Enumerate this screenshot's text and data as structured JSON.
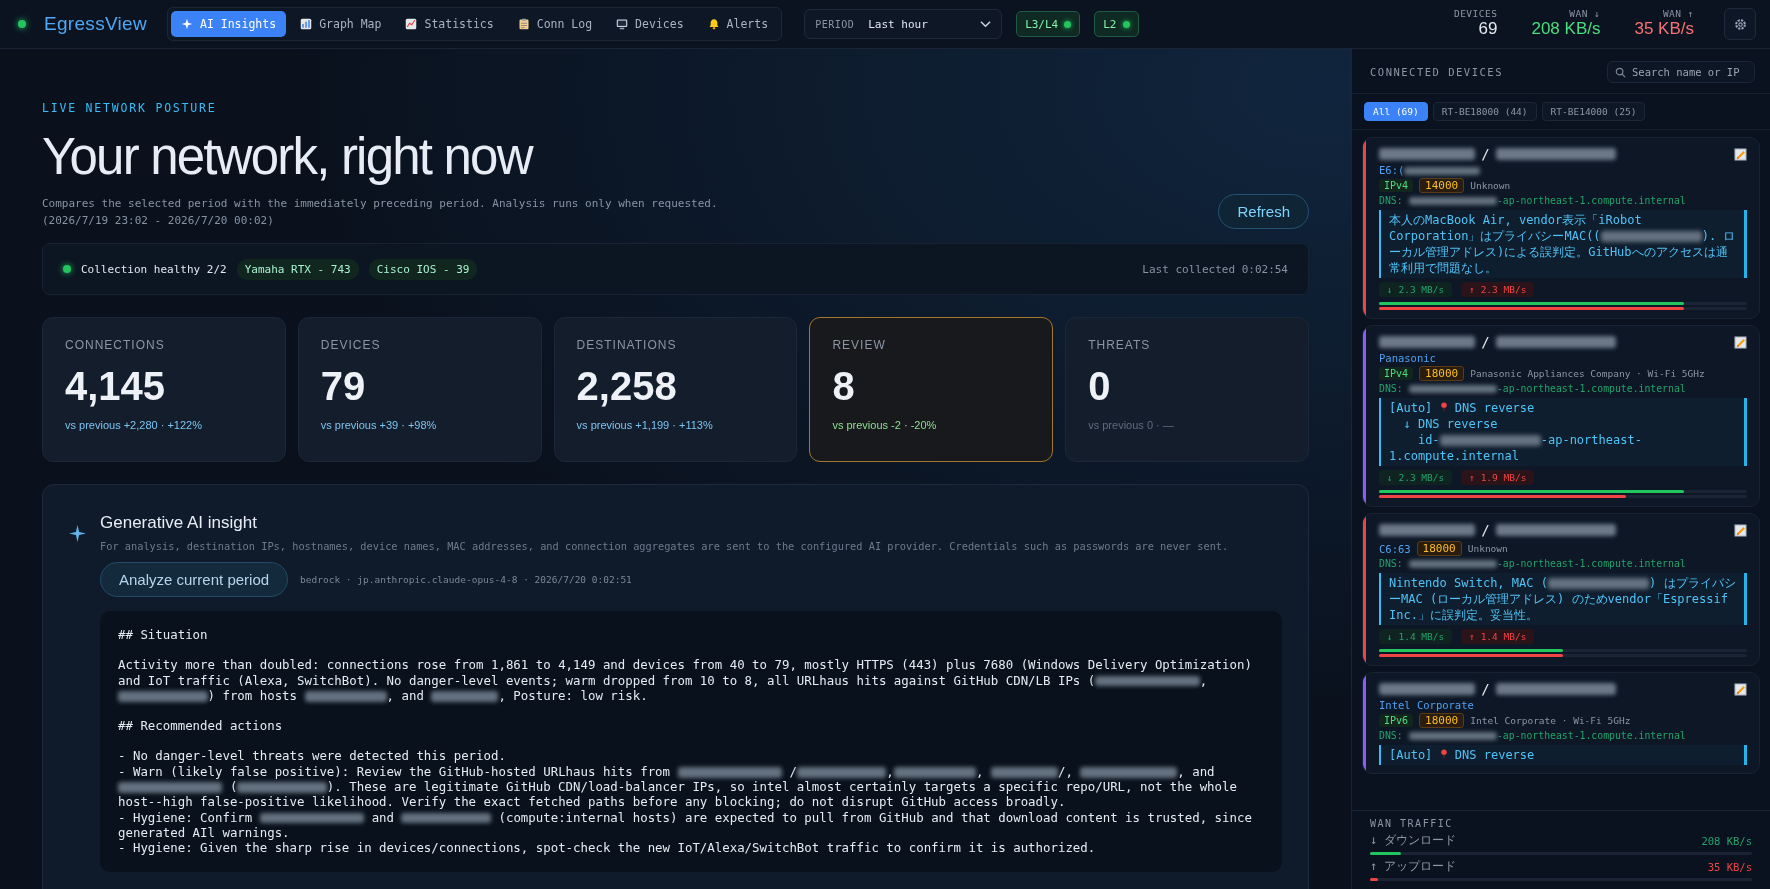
{
  "top_bar": {
    "status": {
      "on": true
    },
    "logo": "EgressView",
    "nav": [
      {
        "label": "AI Insights",
        "selected": true
      },
      {
        "label": "Graph Map",
        "selected": false
      },
      {
        "label": "Statistics",
        "selected": false
      },
      {
        "label": "Conn Log",
        "selected": false
      },
      {
        "label": "Devices",
        "selected": false
      },
      {
        "label": "Alerts",
        "selected": false
      }
    ],
    "period": {
      "label": "PERIOD",
      "value": "Last hour"
    },
    "layers": [
      {
        "label": "L3/L4",
        "on": true
      },
      {
        "label": "L2",
        "on": true
      }
    ],
    "stats": [
      {
        "label": "DEVICES",
        "value": "69",
        "kind": "plain"
      },
      {
        "label": "WAN ↓",
        "value": "208 KB/s",
        "kind": "down"
      },
      {
        "label": "WAN ↑",
        "value": "35 KB/s",
        "kind": "up"
      }
    ]
  },
  "main": {
    "eyebrow": "LIVE NETWORK POSTURE",
    "title": "Your network, right now",
    "subtitle": [
      "Compares the selected period with the immediately preceding period. Analysis runs only when requested.",
      "(2026/7/19 23:02 - 2026/7/20 00:02)"
    ],
    "refresh": "Refresh",
    "collection": {
      "healthy": true,
      "status": "Collection healthy 2/2",
      "sources": [
        "Yamaha RTX - 743",
        "Cisco IOS - 39"
      ],
      "last": "Last collected 0:02:54"
    },
    "cards": [
      {
        "label": "CONNECTIONS",
        "value": "4,145",
        "delta": "vs previous +2,280 · +122%",
        "kind": "info",
        "highlighted": false
      },
      {
        "label": "DEVICES",
        "value": "79",
        "delta": "vs previous +39 · +98%",
        "kind": "info",
        "highlighted": false
      },
      {
        "label": "DESTINATIONS",
        "value": "2,258",
        "delta": "vs previous +1,199 · +113%",
        "kind": "info",
        "highlighted": false
      },
      {
        "label": "REVIEW",
        "value": "8",
        "delta": "vs previous -2 · -20%",
        "kind": "good",
        "highlighted": true
      },
      {
        "label": "THREATS",
        "value": "0",
        "delta": "vs previous 0 · —",
        "kind": "muted",
        "highlighted": false
      }
    ],
    "ai": {
      "title": "Generative AI insight",
      "disclaimer": "For analysis, destination IPs, hostnames, device names, MAC addresses, and connection aggregates are sent to the configured AI provider. Credentials such as passwords are never sent.",
      "button": "Analyze current period",
      "meta": "bedrock · jp.anthropic.claude-opus-4-8 · 2026/7/20 0:02:51",
      "output": [
        {
          "kind": "heading",
          "parts": [
            {
              "kind": "text",
              "text": "## Situation"
            }
          ]
        },
        {
          "kind": "paragraph",
          "parts": [
            {
              "kind": "text",
              "text": "Activity more than doubled: connections rose from 1,861 to 4,149 and devices from 40 to 79, mostly HTTPS (443) plus 7680 (Windows Delivery Optimization) and IoT traffic (Alexa, SwitchBot). No danger-level events; warm dropped from 10 to 8, all URLhaus hits against GitHub CDN/LB IPs ("
            },
            {
              "kind": "redacted"
            },
            {
              "kind": "text",
              "text": ", "
            },
            {
              "kind": "redacted"
            },
            {
              "kind": "text",
              "text": ") from hosts "
            },
            {
              "kind": "redacted"
            },
            {
              "kind": "text",
              "text": ", and "
            },
            {
              "kind": "redacted"
            },
            {
              "kind": "text",
              "text": ", Posture: low risk."
            }
          ]
        },
        {
          "kind": "heading",
          "parts": [
            {
              "kind": "text",
              "text": "## Recommended actions"
            }
          ]
        },
        {
          "kind": "list_item",
          "parts": [
            {
              "kind": "text",
              "text": "- No danger-level threats were detected this period."
            }
          ]
        },
        {
          "kind": "list_item",
          "parts": [
            {
              "kind": "text",
              "text": "- Warn (likely false positive): Review the GitHub-hosted URLhaus hits from "
            },
            {
              "kind": "redacted"
            },
            {
              "kind": "text",
              "text": " /"
            },
            {
              "kind": "redacted"
            },
            {
              "kind": "text",
              "text": ","
            },
            {
              "kind": "redacted"
            },
            {
              "kind": "text",
              "text": ", "
            },
            {
              "kind": "redacted"
            },
            {
              "kind": "text",
              "text": "/, "
            },
            {
              "kind": "redacted"
            },
            {
              "kind": "text",
              "text": ", and "
            },
            {
              "kind": "redacted"
            },
            {
              "kind": "text",
              "text": " ("
            },
            {
              "kind": "redacted"
            },
            {
              "kind": "text",
              "text": "). These are legitimate GitHub CDN/load-balancer IPs, so intel almost certainly targets a specific repo/URL, not the whole host--high false-positive likelihood. Verify the exact fetched paths before any blocking; do not disrupt GitHub access broadly."
            }
          ]
        },
        {
          "kind": "list_item",
          "parts": [
            {
              "kind": "text",
              "text": "- Hygiene: Confirm "
            },
            {
              "kind": "redacted"
            },
            {
              "kind": "text",
              "text": " and "
            },
            {
              "kind": "redacted"
            },
            {
              "kind": "text",
              "text": " (compute:internal hosts) are expected to pull from GitHub and that download content is trusted, since generated AIl warnings."
            }
          ]
        },
        {
          "kind": "list_item",
          "parts": [
            {
              "kind": "text",
              "text": "- Hygiene: Given the sharp rise in devices/connections, spot-check the new IoT/Alexa/SwitchBot traffic to confirm it is authorized."
            }
          ]
        }
      ]
    }
  },
  "devices_panel": {
    "title": "CONNECTED DEVICES",
    "search": {
      "placeholder": "Search name or IP"
    },
    "filters": [
      {
        "label": "All (69)",
        "selected": true
      },
      {
        "label": "RT-BE18000 (44)",
        "selected": false
      },
      {
        "label": "RT-BE14000 (25)",
        "selected": false
      }
    ],
    "devices": [
      {
        "color": "#ef4444",
        "separator": "/",
        "vendor": [
          {
            "kind": "text",
            "text": "E6:("
          },
          {
            "kind": "redacted"
          }
        ],
        "vendor_inline": false,
        "ip_tag": "IPv4",
        "port": "14000",
        "info": "Unknown",
        "dns_label": "DNS:",
        "dns_suffix": "-ap-northeast-1.compute.internal",
        "note": [
          [
            {
              "kind": "text",
              "text": "本人のMacBook Air, vendor表示「iRobot Corporation」はプライバシーMAC(("
            },
            {
              "kind": "redacted"
            },
            {
              "kind": "text",
              "text": "). ローカル管理アドレス)による誤判定。GitHubへのアクセスは通常利用で問題なし。"
            }
          ]
        ],
        "rates": [
          {
            "kind": "down",
            "text": "↓ 2.3 MB/s",
            "level": 0.83
          },
          {
            "kind": "up",
            "text": "↑ 2.3 MB/s",
            "level": 0.83
          }
        ]
      },
      {
        "color": "#8b5cf6",
        "separator": "/",
        "vendor": [
          {
            "kind": "text",
            "text": "Panasonic"
          }
        ],
        "vendor_inline": false,
        "ip_tag": "IPv4",
        "port": "18000",
        "info": "Panasonic Appliances Company · Wi-Fi 5GHz",
        "dns_label": "DNS:",
        "dns_suffix": "-ap-northeast-1.compute.internal",
        "note": [
          [
            {
              "kind": "text",
              "text": "[Auto] "
            },
            {
              "kind": "pin"
            },
            {
              "kind": "text",
              "text": " DNS reverse"
            }
          ],
          [
            {
              "kind": "text",
              "text": "  ↓ DNS reverse"
            }
          ],
          [
            {
              "kind": "text",
              "text": "    id-"
            },
            {
              "kind": "redacted"
            },
            {
              "kind": "text",
              "text": "-ap-northeast-1.compute.internal"
            }
          ]
        ],
        "rates": [
          {
            "kind": "down",
            "text": "↓ 2.3 MB/s",
            "level": 0.83
          },
          {
            "kind": "up",
            "text": "↑ 1.9 MB/s",
            "level": 0.67
          }
        ]
      },
      {
        "color": "#ef4444",
        "separator": "/",
        "vendor": [
          {
            "kind": "text",
            "text": "C6:63"
          }
        ],
        "vendor_inline": true,
        "port": "18000",
        "info": "Unknown",
        "dns_label": "DNS:",
        "dns_suffix": "-ap-northeast-1.compute.internal",
        "note": [
          [
            {
              "kind": "text",
              "text": "Nintendo Switch, MAC ("
            },
            {
              "kind": "redacted"
            },
            {
              "kind": "text",
              "text": ") はプライバシーMAC (ローカル管理アドレス) のためvendor「Espressif Inc.」に誤判定。妥当性。"
            }
          ]
        ],
        "rates": [
          {
            "kind": "down",
            "text": "↓ 1.4 MB/s",
            "level": 0.5
          },
          {
            "kind": "up",
            "text": "↑ 1.4 MB/s",
            "level": 0.5
          }
        ]
      },
      {
        "color": "#8b5cf6",
        "separator": "/",
        "vendor": [
          {
            "kind": "text",
            "text": "Intel Corporate"
          }
        ],
        "vendor_inline": false,
        "ip_tag": "IPv6",
        "port": "18000",
        "info": "Intel Corporate · Wi-Fi 5GHz",
        "dns_label": "DNS:",
        "dns_suffix": "-ap-northeast-1.compute.internal",
        "note": [
          [
            {
              "kind": "text",
              "text": "[Auto] "
            },
            {
              "kind": "pin"
            },
            {
              "kind": "text",
              "text": " DNS reverse"
            }
          ]
        ]
      }
    ]
  },
  "wan_traffic": {
    "title": "WAN TRAFFIC",
    "rows": [
      {
        "kind": "down",
        "label": "↓ ダウンロード",
        "value": "208 KB/s",
        "level": 0.08
      },
      {
        "kind": "up",
        "label": "↑ アップロード",
        "value": "35 KB/s",
        "level": 0.02
      }
    ]
  }
}
